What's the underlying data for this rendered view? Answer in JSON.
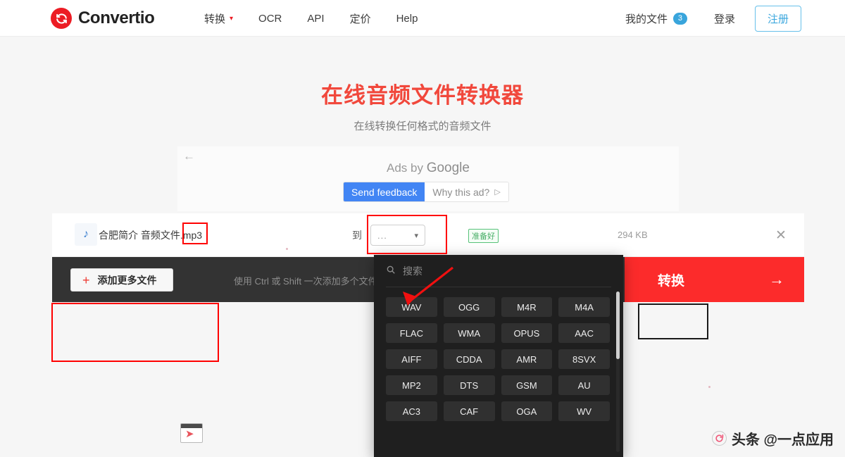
{
  "header": {
    "brand": "Convertio",
    "logo_icon": "convertio-refresh-logo",
    "nav": [
      {
        "label": "转换",
        "has_caret": true,
        "caret_icon": "chevron-down-icon"
      },
      {
        "label": "OCR",
        "has_caret": false
      },
      {
        "label": "API",
        "has_caret": false
      },
      {
        "label": "定价",
        "has_caret": false
      },
      {
        "label": "Help",
        "has_caret": false
      }
    ],
    "my_files_label": "我的文件",
    "my_files_count": "3",
    "login_label": "登录",
    "signup_label": "注册",
    "accent_red": "#ec1c24",
    "accent_blue": "#39a5dc"
  },
  "hero": {
    "title": "在线音频文件转换器",
    "subtitle": "在线转换任何格式的音频文件",
    "title_color": "#f1483c"
  },
  "ads": {
    "back_arrow_icon": "arrow-left-icon",
    "label_prefix": "Ads by ",
    "label_brand": "Google",
    "send_feedback_label": "Send feedback",
    "why_this_ad_label": "Why this ad?",
    "why_this_ad_icon": "triangle-right-icon",
    "feedback_color": "#4285f4"
  },
  "file_row": {
    "music_icon": "music-note-icon",
    "file_name": "合肥简介 音频文件.mp3",
    "to_label": "到",
    "format_placeholder": "...",
    "format_chevron_icon": "chevron-down-icon",
    "status_badge": "准备好",
    "status_color": "#46ad65",
    "file_size": "294 KB",
    "close_icon": "close-icon"
  },
  "actions": {
    "add_more_label": "添加更多文件",
    "add_more_icon": "plus-icon",
    "add_hint": "使用 Ctrl 或 Shift 一次添加多个文件",
    "convert_label": "转换",
    "convert_arrow_icon": "arrow-right-icon",
    "convert_color": "#fc2b2b"
  },
  "dropdown": {
    "search_icon": "search-icon",
    "search_placeholder": "搜索",
    "search_value": "",
    "formats": [
      "WAV",
      "OGG",
      "M4R",
      "M4A",
      "FLAC",
      "WMA",
      "OPUS",
      "AAC",
      "AIFF",
      "CDDA",
      "AMR",
      "8SVX",
      "MP2",
      "DTS",
      "GSM",
      "AU",
      "AC3",
      "CAF",
      "OGA",
      "WV"
    ],
    "scrollbar_icon": "scrollbar-thumb"
  },
  "annotations": {
    "arrow_icon": "red-arrow-pointing-to-wav",
    "box_color": "#ff0000"
  },
  "artifacts": {
    "cursor_card_icon": "browser-window-cursor-icon",
    "watermark_logo_icon": "toutiao-refresh-icon",
    "watermark_text": "头条 @一点应用"
  }
}
